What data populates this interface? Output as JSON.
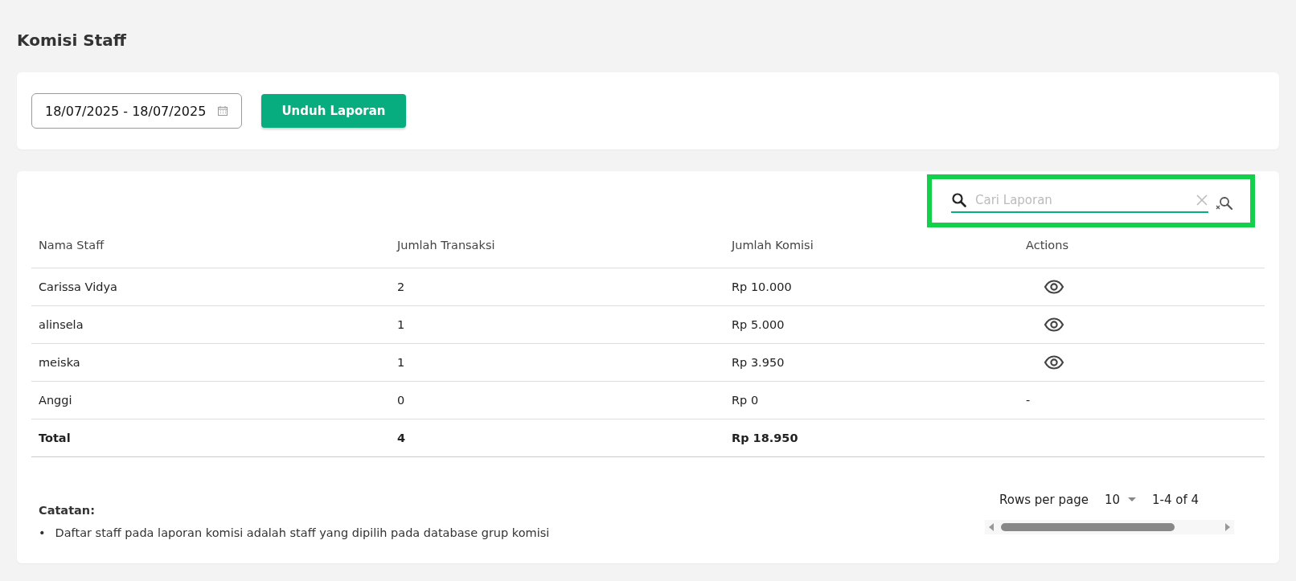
{
  "page_title": "Komisi Staff",
  "filter": {
    "date_range": "18/07/2025 - 18/07/2025",
    "download_button": "Unduh Laporan"
  },
  "search": {
    "placeholder": "Cari Laporan"
  },
  "table": {
    "columns": [
      "Nama Staff",
      "Jumlah Transaksi",
      "Jumlah Komisi",
      "Actions"
    ],
    "rows": [
      {
        "name": "Carissa Vidya",
        "transactions": "2",
        "commission": "Rp 10.000",
        "action": {
          "kind": "view"
        }
      },
      {
        "name": "alinsela",
        "transactions": "1",
        "commission": "Rp 5.000",
        "action": {
          "kind": "view"
        }
      },
      {
        "name": "meiska",
        "transactions": "1",
        "commission": "Rp 3.950",
        "action": {
          "kind": "view"
        }
      },
      {
        "name": "Anggi",
        "transactions": "0",
        "commission": "Rp 0",
        "action": {
          "kind": "text",
          "text": "-"
        }
      }
    ],
    "total": {
      "label": "Total",
      "transactions": "4",
      "commission": "Rp 18.950"
    }
  },
  "note": {
    "title": "Catatan:",
    "items": [
      {
        "bullet": "•",
        "text": "Daftar staff pada laporan komisi adalah staff yang dipilih pada database grup komisi"
      }
    ]
  },
  "pagination": {
    "rows_per_page_label": "Rows per page",
    "rows_per_page": "10",
    "range": "1-4 of 4"
  }
}
